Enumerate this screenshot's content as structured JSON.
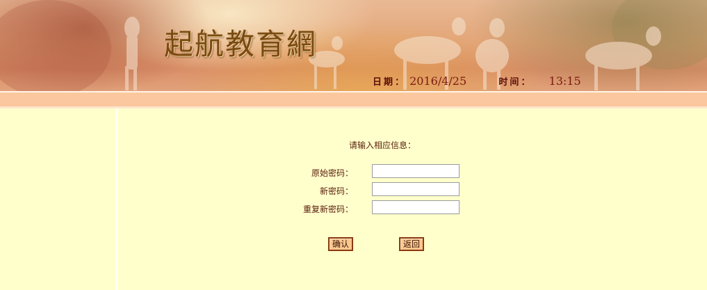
{
  "header": {
    "site_name": "起航教育網",
    "date_label": "日期：",
    "date_value": "2016/4/25",
    "time_label": "时间：",
    "time_value": "13:15"
  },
  "form": {
    "prompt": "请输入相应信息：",
    "old_password_label": "原始密码：",
    "new_password_label": "新密码：",
    "confirm_password_label": "重复新密码：",
    "old_password_value": "",
    "new_password_value": "",
    "confirm_password_value": ""
  },
  "buttons": {
    "confirm_label": "确认",
    "back_label": "返回"
  },
  "colors": {
    "page_background": "#ffffcc",
    "stripe": "#fbc79e",
    "button_fill": "#fbc88f",
    "button_border": "#8a3a12",
    "label_text": "#5a1e0c"
  }
}
